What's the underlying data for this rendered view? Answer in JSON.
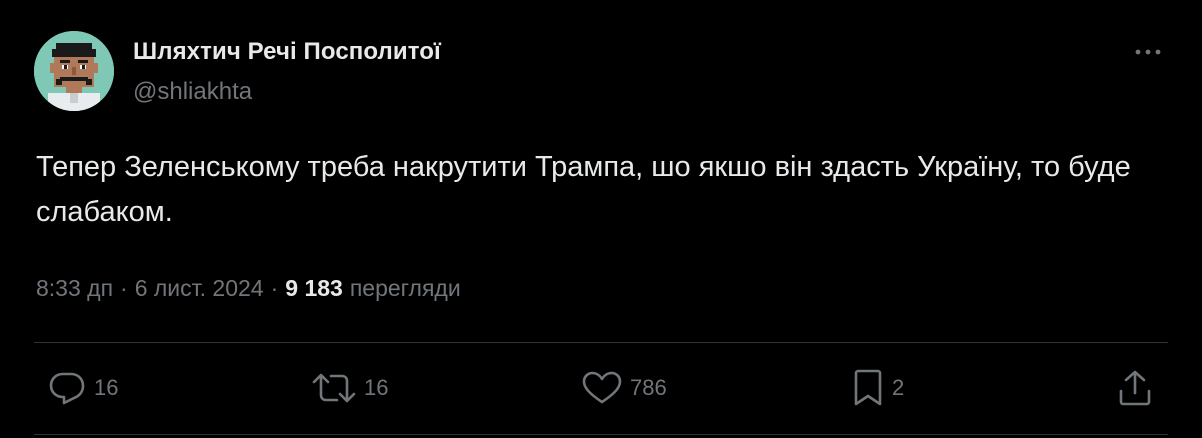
{
  "author": {
    "name": "Шляхтич Речі Посполитої",
    "handle": "@shliakhta",
    "avatar_colors": {
      "background": "#7ec8b5",
      "hair": "#1a1a1a",
      "skin": "#b07a5a",
      "shirt": "#e9ecef"
    }
  },
  "post": {
    "text": "Тепер Зеленському треба накрутити Трампа, шо якшо він здасть Україну, то буде слабаком."
  },
  "meta": {
    "time": "8:33 дп",
    "separator": "·",
    "date": "6 лист. 2024",
    "views_count": "9 183",
    "views_label": "перегляди"
  },
  "actions": {
    "replies": "16",
    "reposts": "16",
    "likes": "786",
    "bookmarks": "2"
  },
  "icons": {
    "more": "more-horizontal-icon",
    "reply": "reply-icon",
    "repost": "repost-icon",
    "like": "heart-icon",
    "bookmark": "bookmark-icon",
    "share": "share-icon"
  },
  "colors": {
    "background": "#000000",
    "primary_text": "#e7e9ea",
    "secondary_text": "#71767b",
    "divider": "#2f3336"
  }
}
